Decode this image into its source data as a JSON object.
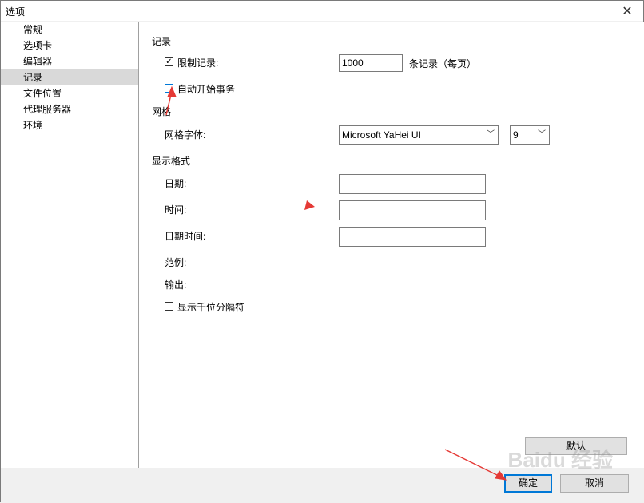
{
  "window": {
    "title": "选项",
    "close_label": "✕"
  },
  "nav": {
    "items": [
      "常规",
      "选项卡",
      "编辑器",
      "记录",
      "文件位置",
      "代理服务器",
      "环境"
    ]
  },
  "records": {
    "heading": "记录",
    "limit_label": "限制记录:",
    "limit_checked": true,
    "limit_value": "1000",
    "limit_suffix": "条记录（每页）",
    "auto_tx_label": "自动开始事务",
    "auto_tx_checked": false
  },
  "grid": {
    "heading": "网格",
    "font_label": "网格字体:",
    "font_value": "Microsoft YaHei UI",
    "size_value": "9"
  },
  "format": {
    "heading": "显示格式",
    "date_label": "日期:",
    "date_value": "",
    "time_label": "时间:",
    "time_value": "",
    "datetime_label": "日期时间:",
    "datetime_value": "",
    "example_label": "范例:",
    "output_label": "输出:",
    "thousands_label": "显示千位分隔符",
    "thousands_checked": false
  },
  "buttons": {
    "default_label": "默认",
    "ok_label": "确定",
    "cancel_label": "取消"
  },
  "watermark": "Baidu 经验",
  "icons": {
    "check": "checkmark-icon",
    "close": "close-icon",
    "dropdown": "chevron-down-icon"
  },
  "colors": {
    "annotation": "#e53935",
    "focus": "#0078d7"
  }
}
